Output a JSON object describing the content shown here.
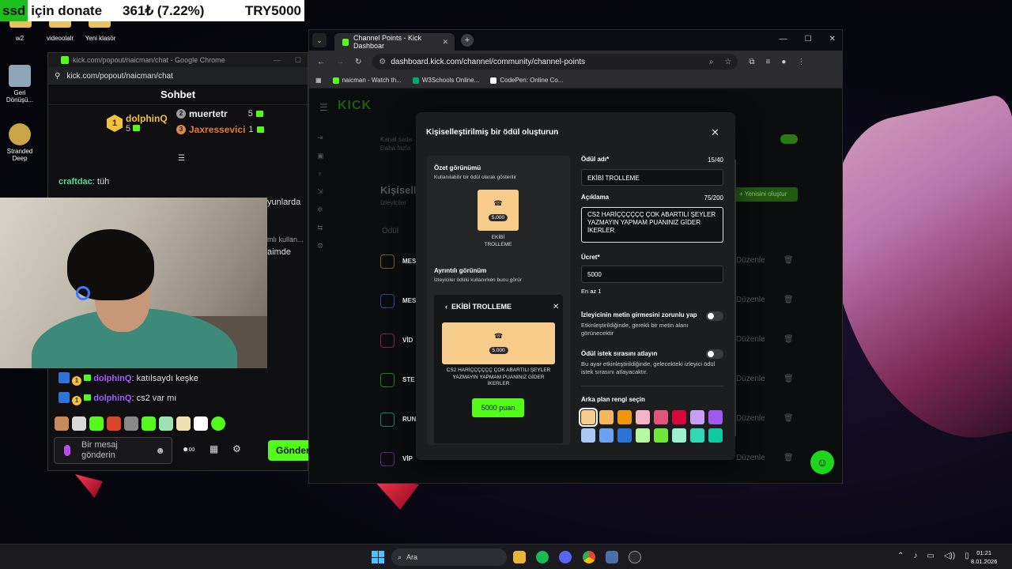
{
  "ticker": {
    "badge": "ssd",
    "label": "için donate",
    "amount": "361₺ (7.22%)",
    "goal": "TRY5000"
  },
  "desktop": {
    "top_icons": [
      "w2",
      "videoolalr",
      "Yeni klasör"
    ],
    "icons": [
      {
        "label": "Geri\nDönüşü...",
        "icon": "recycle-bin-icon"
      },
      {
        "label": "Stranded\nDeep",
        "icon": "game-icon"
      }
    ]
  },
  "chat_window": {
    "title": "kick.com/popout/naicman/chat - Google Chrome",
    "url": "kick.com/popout/naicman/chat",
    "header": "Sohbet",
    "leaderboard": {
      "first": {
        "rank": "1",
        "name": "dolphinQ",
        "count": "5"
      },
      "second": {
        "rank": "2",
        "name": "muertetr",
        "count": "5"
      },
      "third": {
        "rank": "3",
        "name": "Jaxressevici",
        "count": "1"
      }
    },
    "messages": [
      {
        "user": "craftdac",
        "text": "tüh"
      },
      {
        "user": "dolphinQ",
        "text": "katılsaydı keşke"
      },
      {
        "user": "dolphinQ",
        "text": "cs2 var mı"
      }
    ],
    "side_snippets": [
      "yunlarda",
      "mlı kullan...",
      "aimde"
    ],
    "composer_placeholder": "Bir mesaj gönderin",
    "send_label": "Gönder",
    "chat_tools": {
      "infinity": "∞"
    }
  },
  "browser": {
    "tab_title": "Channel Points - Kick Dashboar",
    "url": "dashboard.kick.com/channel/community/channel-points",
    "bookmarks": [
      "naicman - Watch th...",
      "W3Schools Online...",
      "CodePen: Online Co..."
    ]
  },
  "kick_bg": {
    "logo": "KICK",
    "info_text": [
      "Kanal sada",
      "Daha fazla"
    ],
    "section_title": "Kişiselleş",
    "section_sub": "İzleyiciler",
    "new_button": "+ Yenisini oluştur",
    "table_header": "Ödül",
    "rows": [
      {
        "label": "MES",
        "edit": "Düzenle"
      },
      {
        "label": "MES",
        "edit": "Düzenle"
      },
      {
        "label": "VİD",
        "edit": "Düzenle"
      },
      {
        "label": "STE",
        "edit": "Düzenle"
      },
      {
        "label": "RUN",
        "edit": "Düzenle"
      },
      {
        "label": "VİP",
        "edit": "Düzenle"
      }
    ]
  },
  "modal": {
    "title": "Kişiselleştirilmiş bir ödül oluşturun",
    "summary": {
      "heading": "Özet görünümü",
      "sub": "Kullanılabilir bir ödül olarak gösterilir",
      "cost": "5.000",
      "label_line1": "EKİBİ",
      "label_line2": "TROLLEME"
    },
    "detail": {
      "heading": "Ayrıntılı görünüm",
      "sub": "İzleyiciler ödülü kullanırken bunu görür",
      "reward_name": "EKİBİ TROLLEME",
      "cost": "5.000",
      "description": "CS2 HARİÇÇÇÇÇÇ ÇOK ABARTILI ŞEYLER YAZMAYIN YAPMAM PUANINIZ GİDER İKERLER",
      "button": "5000 puan"
    },
    "form": {
      "name_label": "Ödül adı*",
      "name_counter": "15/40",
      "name_value": "EKİBİ TROLLEME",
      "desc_label": "Açıklama",
      "desc_counter": "75/200",
      "desc_value": "CS2 HARİÇÇÇÇÇÇ ÇOK ABARTILI ŞEYLER YAZMAYIN YAPMAM PUANINIZ GİDER İKERLER",
      "cost_label": "Ücret*",
      "cost_value": "5000",
      "cost_help": "En az 1",
      "toggle1_label": "İzleyicinin metin girmesini zorunlu yap",
      "toggle1_help": "Etkinleştirildiğinde, gerekli bir metin alanı görünecektir",
      "toggle1_on": false,
      "toggle2_label": "Ödül istek sırasını atlayın",
      "toggle2_help": "Bu ayar etkinleştirildiğinde, gelecekteki izleyici ödül istek sırasını atlayacaktır.",
      "toggle2_on": false,
      "color_label": "Arka plan rengi seçin",
      "colors": [
        "#f8cd8c",
        "#f6b65e",
        "#f0960a",
        "#f6b3c5",
        "#e0557c",
        "#d6073f",
        "#c99cf5",
        "#a05af0",
        "#a9c8f7",
        "#6aa2ef",
        "#2a74d8",
        "#b8f7a0",
        "#6ee83a",
        "#9ef0d0",
        "#2edab3",
        "#11c9a0"
      ],
      "selected_color": "#f8cd8c"
    }
  },
  "taskbar": {
    "search": "Ara",
    "time": "01:21",
    "date": "8.01.2026"
  }
}
